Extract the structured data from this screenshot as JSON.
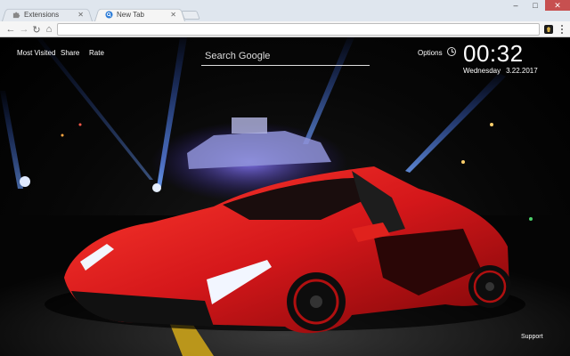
{
  "browser": {
    "tabs": [
      {
        "title": "Extensions",
        "icon": "puzzle-icon",
        "active": false
      },
      {
        "title": "New Tab",
        "icon": "search-globe-icon",
        "active": true
      }
    ],
    "window_controls": {
      "minimize": "–",
      "maximize": "□",
      "close": "✕"
    },
    "nav": {
      "back": "←",
      "forward": "→",
      "reload": "↻",
      "home": "⌂"
    },
    "omnibox": {
      "value": "",
      "placeholder": ""
    },
    "extension_icon": "lamborghini-logo-icon"
  },
  "newtab": {
    "top_links": [
      "Most Visited",
      "Share",
      "Rate"
    ],
    "search": {
      "placeholder": "Search Google"
    },
    "options_label": "Options",
    "clock": {
      "time": "00:32",
      "weekday": "Wednesday",
      "date": "3.22.2017"
    },
    "support_label": "Support",
    "background": "red-lamborghini-veneno-night-wallpaper"
  },
  "colors": {
    "tabstrip": "#dfe6ee",
    "toolbar": "#f5f5f5",
    "car_red": "#d81e1e",
    "beam_blue": "#3d7bff",
    "close_btn": "#c75050"
  }
}
